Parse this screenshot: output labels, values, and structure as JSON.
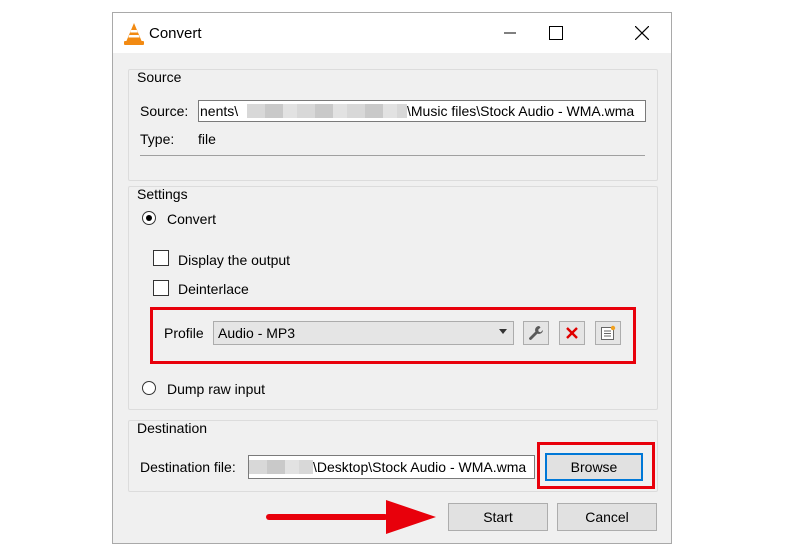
{
  "window": {
    "title": "Convert"
  },
  "source": {
    "group_label": "Source",
    "source_label": "Source:",
    "source_value_left": "nents\\",
    "source_value_right": "\\Music files\\Stock Audio - WMA.wma",
    "type_label": "Type:",
    "type_value": "file"
  },
  "settings": {
    "group_label": "Settings",
    "convert_label": "Convert",
    "display_output_label": "Display the output",
    "deinterlace_label": "Deinterlace",
    "profile_label": "Profile",
    "profile_value": "Audio - MP3",
    "dump_raw_label": "Dump raw input"
  },
  "destination": {
    "group_label": "Destination",
    "file_label": "Destination file:",
    "file_value": "\\Desktop\\Stock Audio - WMA.wma",
    "browse_label": "Browse"
  },
  "footer": {
    "start_label": "Start",
    "cancel_label": "Cancel"
  },
  "colors": {
    "highlight": "#e8000b",
    "accent": "#0078d7"
  },
  "icons": [
    "vlc-cone-icon",
    "minimize-icon",
    "maximize-icon",
    "close-icon",
    "wrench-icon",
    "delete-icon",
    "new-profile-icon",
    "arrow-icon"
  ]
}
